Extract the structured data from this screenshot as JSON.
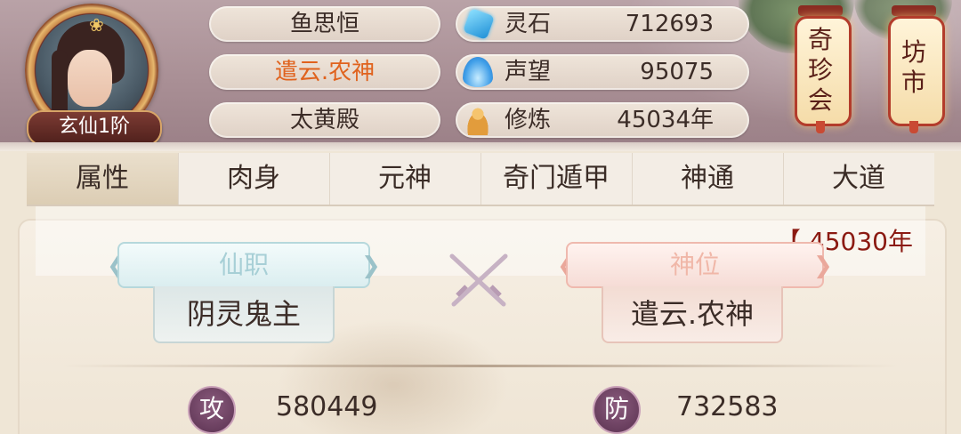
{
  "player": {
    "name": "鱼思恒",
    "title": "遣云.农神",
    "sect": "太黄殿",
    "rank": "玄仙1阶"
  },
  "resources": [
    {
      "icon": "spirit-stone-icon",
      "label": "灵石",
      "value": "712693"
    },
    {
      "icon": "reputation-icon",
      "label": "声望",
      "value": "95075"
    },
    {
      "icon": "cultivation-icon",
      "label": "修炼",
      "value": "45034年"
    }
  ],
  "lanterns": {
    "treasure_fair": "奇珍会",
    "market": "坊市"
  },
  "tabs": [
    "属性",
    "肉身",
    "元神",
    "奇门遁甲",
    "神通",
    "大道"
  ],
  "active_tab": "属性",
  "details": {
    "timer": "【 45030年",
    "immortal_post_label": "仙职",
    "immortal_post_value": "阴灵鬼主",
    "divine_rank_label": "神位",
    "divine_rank_value": "遣云.农神"
  },
  "stats": {
    "attack_glyph": "攻",
    "attack_value": "580449",
    "defense_glyph": "防",
    "defense_value": "732583"
  },
  "colors": {
    "title_orange": "#e0621d",
    "timer_red": "#8b1a12",
    "post_teal": "#a7cfd6",
    "rank_pink": "#f0b7a8"
  }
}
